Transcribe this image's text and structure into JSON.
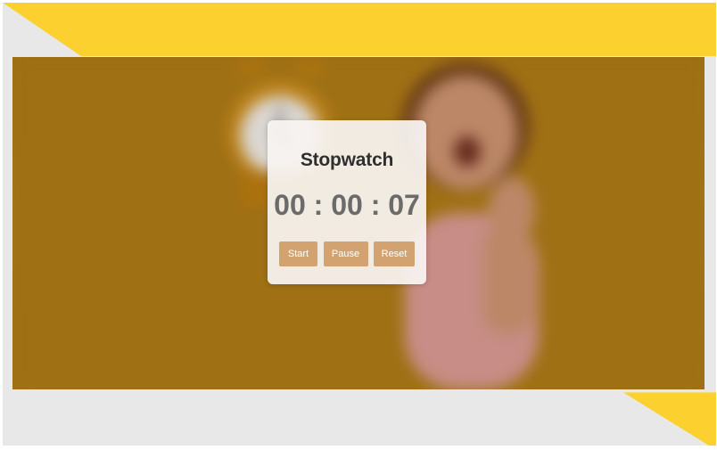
{
  "app": {
    "title": "Stopwatch"
  },
  "timer": {
    "hours": "00",
    "minutes": "00",
    "seconds": "07",
    "display": "00 : 00 : 07"
  },
  "controls": {
    "start_label": "Start",
    "pause_label": "Pause",
    "reset_label": "Reset"
  },
  "colors": {
    "accent_yellow": "#fcd02f",
    "background_gray": "#e8e8e8",
    "button_fill": "#d2a371",
    "button_text": "#ffffff",
    "card_bg": "#f8f4f2",
    "title_text": "#2f2f2f",
    "timer_text": "#6b6b6b"
  },
  "icons": {
    "hero_clock": "alarm-clock-icon"
  }
}
